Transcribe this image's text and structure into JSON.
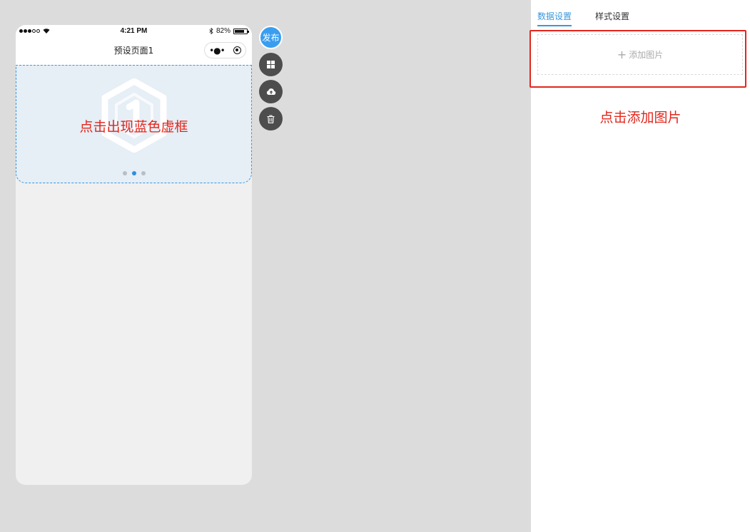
{
  "phone": {
    "status": {
      "time": "4:21 PM",
      "battery": "82%",
      "battery_level": 0.82
    },
    "navbar": {
      "title": "预设页面1"
    },
    "banner": {
      "annotation": "点击出现蓝色虚框",
      "active_dot": 1,
      "dot_count": 3
    }
  },
  "fabs": {
    "publish_label": "发布",
    "icons": [
      "grid-icon",
      "cloud-upload-icon",
      "trash-icon"
    ]
  },
  "panel": {
    "tabs": [
      {
        "label": "数据设置",
        "active": true
      },
      {
        "label": "样式设置",
        "active": false
      }
    ],
    "add_image_label": "添加图片",
    "annotation": "点击添加图片"
  },
  "colors": {
    "accent": "#3a97dc",
    "annotation_red": "#e3261c",
    "background": "#dcdcdc"
  }
}
